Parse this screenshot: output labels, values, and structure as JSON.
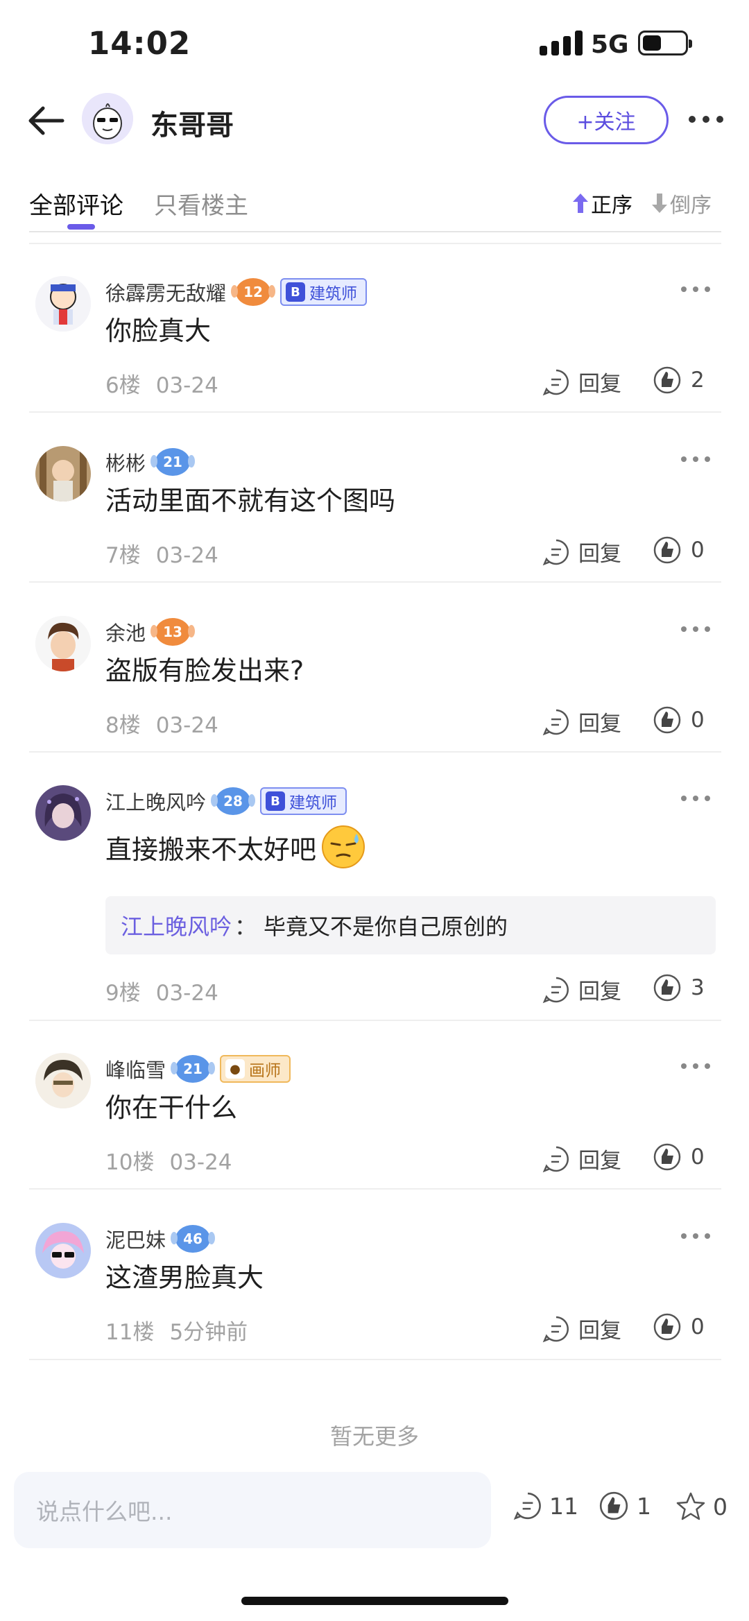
{
  "status": {
    "time": "14:02",
    "network": "5G"
  },
  "header": {
    "author": "东哥哥",
    "follow_label": "+关注"
  },
  "tabs": {
    "all": "全部评论",
    "owner_only": "只看楼主",
    "sort_asc": "正序",
    "sort_desc": "倒序"
  },
  "comments": [
    {
      "user": "徐霹雳无敌耀",
      "level": "12",
      "badge": "建筑师",
      "text": "你脸真大",
      "floor": "6楼",
      "date": "03-24",
      "reply": "回复",
      "likes": "2"
    },
    {
      "user": "彬彬",
      "level": "21",
      "text": "活动里面不就有这个图吗",
      "floor": "7楼",
      "date": "03-24",
      "reply": "回复",
      "likes": "0"
    },
    {
      "user": "余池",
      "level": "13",
      "text": "盗版有脸发出来?",
      "floor": "8楼",
      "date": "03-24",
      "reply": "回复",
      "likes": "0"
    },
    {
      "user": "江上晚风吟",
      "level": "28",
      "badge": "建筑师",
      "text": "直接搬来不太好吧",
      "sub_reply": {
        "user": "江上晚风吟",
        "sep": "：",
        "text": "毕竟又不是你自己原创的"
      },
      "floor": "9楼",
      "date": "03-24",
      "reply": "回复",
      "likes": "3"
    },
    {
      "user": "峰临雪",
      "level": "21",
      "badge": "画师",
      "text": "你在干什么",
      "floor": "10楼",
      "date": "03-24",
      "reply": "回复",
      "likes": "0"
    },
    {
      "user": "泥巴妹",
      "level": "46",
      "text": "这渣男脸真大",
      "floor": "11楼",
      "date": "5分钟前",
      "reply": "回复",
      "likes": "0"
    }
  ],
  "footer": {
    "no_more": "暂无更多",
    "input_placeholder": "说点什么吧...",
    "comment_count": "11",
    "like_count": "1",
    "star_count": "0"
  },
  "colors": {
    "accent": "#6a5be8",
    "level_orange": "#f08b3d",
    "level_blue": "#5a95e8"
  }
}
